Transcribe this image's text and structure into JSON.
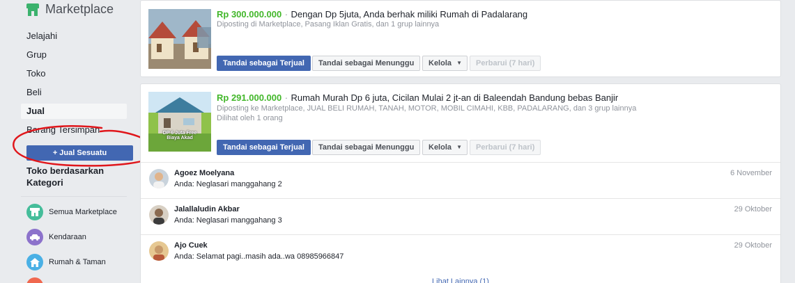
{
  "sidebar": {
    "title": "Marketplace",
    "nav": [
      {
        "label": "Jelajahi",
        "active": false
      },
      {
        "label": "Grup",
        "active": false
      },
      {
        "label": "Toko",
        "active": false
      },
      {
        "label": "Beli",
        "active": false
      },
      {
        "label": "Jual",
        "active": true
      },
      {
        "label": "Barang Tersimpan",
        "active": false
      }
    ],
    "sell_button": "+ Jual Sesuatu",
    "categories_heading": "Toko berdasarkan Kategori",
    "categories": [
      {
        "label": "Semua Marketplace",
        "icon": "storefront-icon",
        "color": "#45bd9a"
      },
      {
        "label": "Kendaraan",
        "icon": "car-icon",
        "color": "#8c72cb"
      },
      {
        "label": "Rumah & Taman",
        "icon": "house-icon",
        "color": "#4ab0e5"
      },
      {
        "label": "",
        "icon": "category-icon",
        "color": "#f0684f"
      }
    ]
  },
  "listings": [
    {
      "price": "Rp 300.000.000",
      "separator": "·",
      "title": "Dengan Dp 5juta, Anda berhak miliki Rumah di Padalarang",
      "meta": "Diposting di Marketplace, Pasang Iklan Gratis, dan 1 grup lainnya",
      "views": "",
      "thumb_caption": "SEMUA BISA PUNYA RUMAH DP 5JUTA",
      "buttons": {
        "sold": "Tandai sebagai Terjual",
        "pending": "Tandai sebagai Menunggu",
        "manage": "Kelola",
        "renew": "Perbarui (7 hari)"
      }
    },
    {
      "price": "Rp 291.000.000",
      "separator": "·",
      "title": "Rumah Murah Dp 6 juta, Cicilan Mulai 2 jt-an di Baleendah Bandung bebas Banjir",
      "meta": "Diposting ke Marketplace, JUAL BELI RUMAH, TANAH, MOTOR, MOBIL CIMAHI, KBB, PADALARANG, dan 3 grup lainnya",
      "views": "Dilihat oleh 1 orang",
      "thumb_caption": "DP 6 Juta Free Biaya Akad",
      "buttons": {
        "sold": "Tandai sebagai Terjual",
        "pending": "Tandai sebagai Menunggu",
        "manage": "Kelola",
        "renew": "Perbarui (7 hari)"
      }
    }
  ],
  "messages": [
    {
      "name": "Agoez Moelyana",
      "text": "Anda: Neglasari manggahang 2",
      "date": "6 November"
    },
    {
      "name": "Jalallaludin Akbar",
      "text": "Anda: Neglasari manggahang 3",
      "date": "29 Oktober"
    },
    {
      "name": "Ajo Cuek",
      "text": "Anda: Selamat pagi..masih ada..wa 08985966847",
      "date": "29 Oktober"
    }
  ],
  "see_more": "Lihat Lainnya (1)",
  "colors": {
    "accent": "#4267b2",
    "price": "#42b72a",
    "annotation": "#e0161b"
  }
}
